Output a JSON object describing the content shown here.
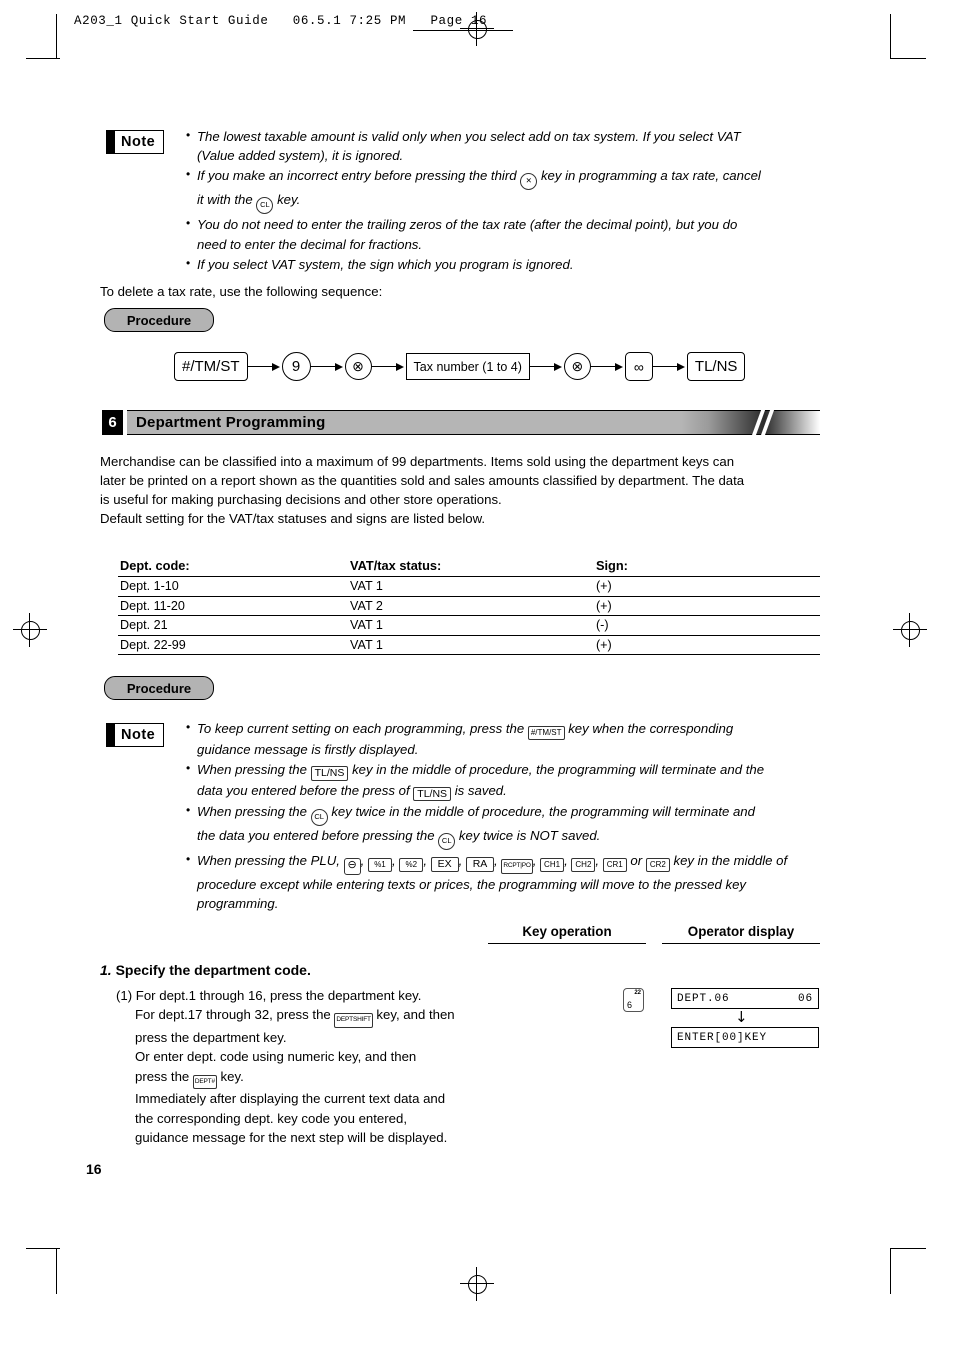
{
  "running_head": "A203_1 Quick Start Guide   06.5.1 7:25 PM   Page 16",
  "page_number": "16",
  "note_top": {
    "label": "Note",
    "items": [
      {
        "text": "The lowest taxable amount is valid only when you select add on tax system. If you select VAT",
        "cont": "(Value added system), it is ignored."
      },
      {
        "pre": "If you make an incorrect entry before pressing the third",
        "key": "multiply-circle",
        "post": "key in programming a tax rate, cancel",
        "cont_pre": "it with the",
        "cont_key": "CL",
        "cont_post": "key."
      },
      {
        "text": "You do not need to enter the trailing zeros of the tax rate (after the decimal point), but you do",
        "cont": "need to enter the decimal for fractions."
      },
      {
        "text": "If you select VAT system, the sign which you program is ignored."
      }
    ]
  },
  "delete_intro": "To delete a tax rate, use the following sequence:",
  "procedure_label": "Procedure",
  "flow": {
    "nodes": [
      {
        "type": "rect",
        "label": "#/TM/ST"
      },
      {
        "type": "circle",
        "label": "9"
      },
      {
        "type": "circle-x",
        "label": "⊗"
      },
      {
        "type": "box",
        "label": "Tax number (1 to 4)"
      },
      {
        "type": "circle-x",
        "label": "⊗"
      },
      {
        "type": "small",
        "label": "∞"
      },
      {
        "type": "rect",
        "label": "TL/NS"
      }
    ]
  },
  "section": {
    "number": "6",
    "title": "Department Programming",
    "paragraphs": [
      "Merchandise can be classified into a maximum of 99 departments.  Items sold using the department keys can",
      "later be printed on a report shown as the quantities sold and sales amounts classified by department.  The data",
      "is useful for making purchasing decisions and other store operations.",
      "Default setting for the VAT/tax statuses and signs are listed below."
    ]
  },
  "table": {
    "headers": [
      "Dept. code:",
      "VAT/tax status:",
      "Sign:"
    ],
    "rows": [
      [
        "Dept. 1-10",
        "VAT 1",
        "(+)"
      ],
      [
        "Dept. 11-20",
        "VAT 2",
        "(+)"
      ],
      [
        "Dept. 21",
        "VAT 1",
        "(-)"
      ],
      [
        "Dept. 22-99",
        "VAT 1",
        "(+)"
      ]
    ]
  },
  "procedure_label_2": "Procedure",
  "note_bottom": {
    "label": "Note",
    "b1_pre": "To keep current setting on each programming, press the",
    "b1_key": "#/TM/ST",
    "b1_post": "key when the corresponding",
    "b1_cont": "guidance message is firstly displayed.",
    "b2_pre": "When pressing the",
    "b2_key": "TL/NS",
    "b2_post": "key in the middle of procedure, the programming will terminate and the",
    "b2_cont_pre": "data you entered before the press of",
    "b2_cont_key": "TL/NS",
    "b2_cont_post": "is saved.",
    "b3_pre": "When pressing the",
    "b3_key": "CL",
    "b3_post": "key twice in the middle of procedure, the programming will terminate and",
    "b3_cont_pre": "the data you entered before pressing the",
    "b3_cont_key": "CL",
    "b3_cont_post": "key twice is NOT saved.",
    "b4_pre": "When pressing the PLU,",
    "b4_keys": [
      "⊖",
      "%1",
      "%2",
      "EX",
      "RA",
      "RCPT|PO",
      "CH1",
      "CH2",
      "CR1"
    ],
    "b4_or": "or",
    "b4_last_key": "CR2",
    "b4_post": "key in the middle of",
    "b4_cont": "procedure except while entering texts or prices, the programming will move to the pressed key",
    "b4_cont2": "programming."
  },
  "columns": {
    "key_operation": "Key operation",
    "operator_display": "Operator display"
  },
  "step": {
    "number": "1.",
    "title": "Specify the department code.",
    "item_marker": "(1)",
    "lines": [
      "For dept.1 through 16, press the department key.",
      "For dept.17 through 32, press the",
      "press the department key.",
      "Or enter dept. code using numeric key, and then",
      "press the",
      "Immediately after displaying the current text data and",
      "the corresponding dept. key code you entered,",
      "guidance message for the next step will be displayed."
    ],
    "key_deptshift": "DEPTSHIFT",
    "key_deptnum": "DEPT#",
    "key_word": "key, and then",
    "key_word2": "key."
  },
  "key_operation_key": {
    "sup": "22",
    "main": "6"
  },
  "displays": {
    "first_left": "DEPT.06",
    "first_right": "06",
    "arrow": "↓",
    "second": "ENTER[00]KEY"
  }
}
